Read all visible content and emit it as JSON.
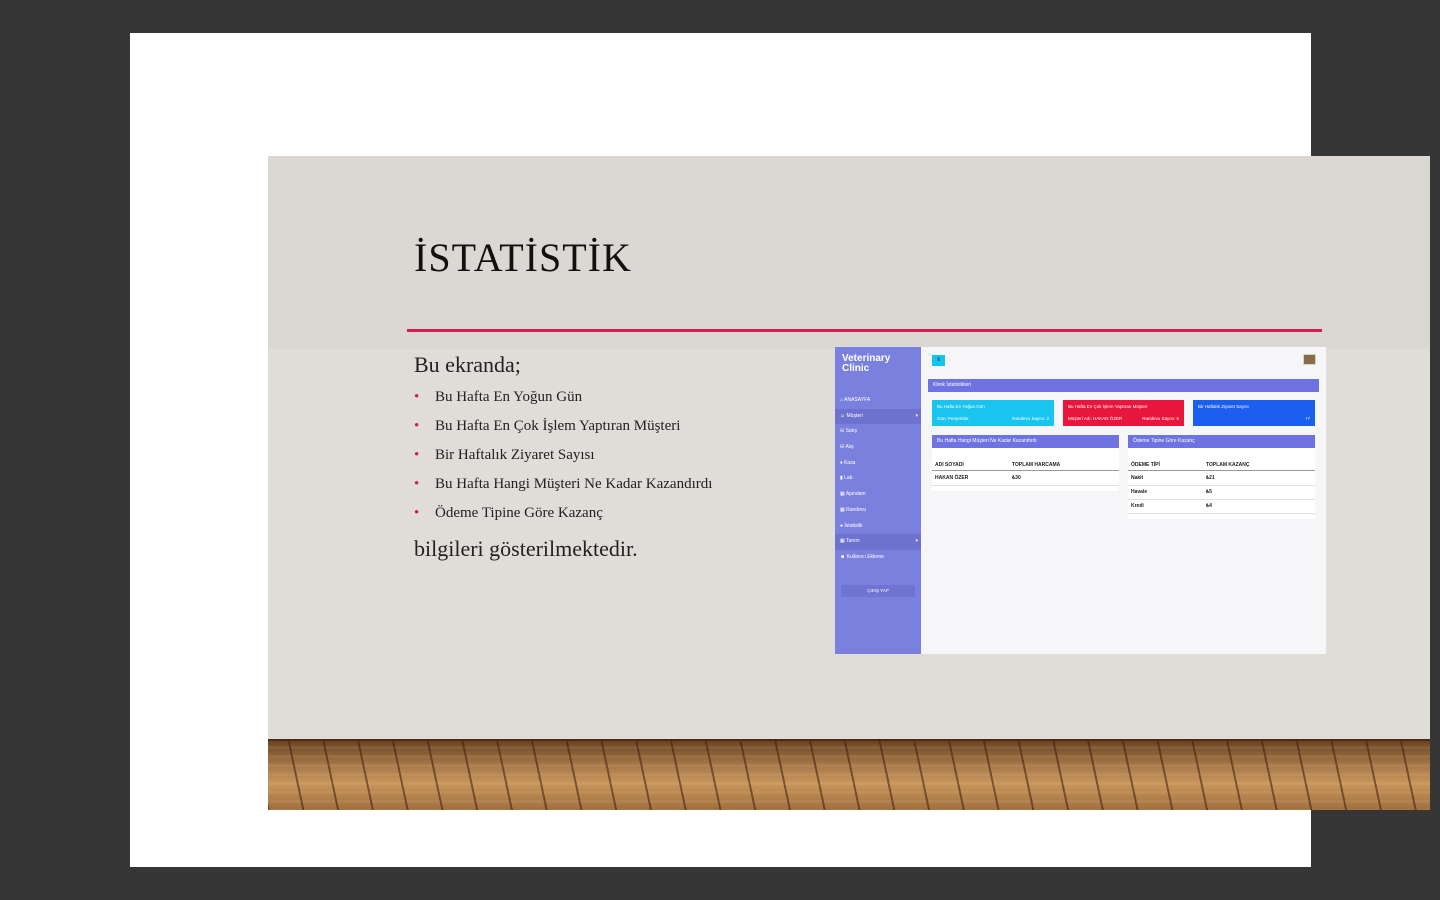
{
  "slide": {
    "title": "İSTATİSTİK",
    "intro": "Bu ekranda;",
    "bullets": [
      "Bu Hafta En Yoğun Gün",
      "Bu Hafta En Çok İşlem Yaptıran Müşteri",
      "Bir Haftalık Ziyaret Sayısı",
      "Bu Hafta Hangi Müşteri Ne Kadar Kazandırdı",
      "Ödeme Tipine Göre Kazanç"
    ],
    "outro": "bilgileri gösterilmektedir.",
    "accent_color": "#d81b52",
    "bullet_color": "#d81b52"
  },
  "app": {
    "brand": "Veterinary Clinic",
    "nav": [
      {
        "label": "ANASAYFA",
        "icon": "home-icon",
        "glyph": "⌂",
        "caret": ""
      },
      {
        "label": "Müşteri",
        "icon": "users-icon",
        "glyph": "☺",
        "caret": "▾"
      },
      {
        "label": "Satış",
        "icon": "sale-icon",
        "glyph": "⛁",
        "caret": ""
      },
      {
        "label": "Alış",
        "icon": "purchase-icon",
        "glyph": "⛁",
        "caret": ""
      },
      {
        "label": "Kasa",
        "icon": "cash-icon",
        "glyph": "♦",
        "caret": ""
      },
      {
        "label": "Lab",
        "icon": "lab-icon",
        "glyph": "▮",
        "caret": ""
      },
      {
        "label": "Ajandam",
        "icon": "calendar-icon",
        "glyph": "▦",
        "caret": ""
      },
      {
        "label": "Randevu",
        "icon": "appointment-icon",
        "glyph": "▦",
        "caret": ""
      },
      {
        "label": "İstatistik",
        "icon": "stats-icon",
        "glyph": "●",
        "caret": ""
      },
      {
        "label": "Tanım",
        "icon": "definition-icon",
        "glyph": "▦",
        "caret": "▾"
      },
      {
        "label": "Kullanıcı Ekleme",
        "icon": "user-add-icon",
        "glyph": "☻",
        "caret": ""
      }
    ],
    "logout_label": "ÇIKIŞ YAP",
    "section_title": "Klinik İstatistikleri",
    "cards": [
      {
        "title": "Bu Hafta En Yoğun Gün",
        "left": "Gün: Perşembe",
        "right": "Randevu Sayısı: 2",
        "color": "#19c4ee"
      },
      {
        "title": "Bu Hafta En Çok İşlem Yaptıran Müşteri",
        "left": "Müşteri Adı: HAKAN ÖZER",
        "right": "Randevu Sayısı: 6",
        "color": "#e8163c"
      },
      {
        "title": "Bir Haftalık Ziyaret Sayısı",
        "left": "",
        "right": "+7",
        "color": "#1a5ff0"
      }
    ],
    "customer_table": {
      "title": "Bu Hafta Hangi Müşteri Ne Kadar Kazandırdı",
      "columns": [
        "ADI SOYADI",
        "TOPLAM HARCAMA"
      ],
      "rows": [
        [
          "HAKAN ÖZER",
          "₺30"
        ]
      ]
    },
    "payment_table": {
      "title": "Ödeme Tipine Göre Kazanç",
      "columns": [
        "ÖDEME TİPİ",
        "TOPLAM KAZANÇ"
      ],
      "rows": [
        [
          "Nakit",
          "₺21"
        ],
        [
          "Havale",
          "₺5"
        ],
        [
          "Kredi",
          "₺4"
        ]
      ]
    }
  }
}
